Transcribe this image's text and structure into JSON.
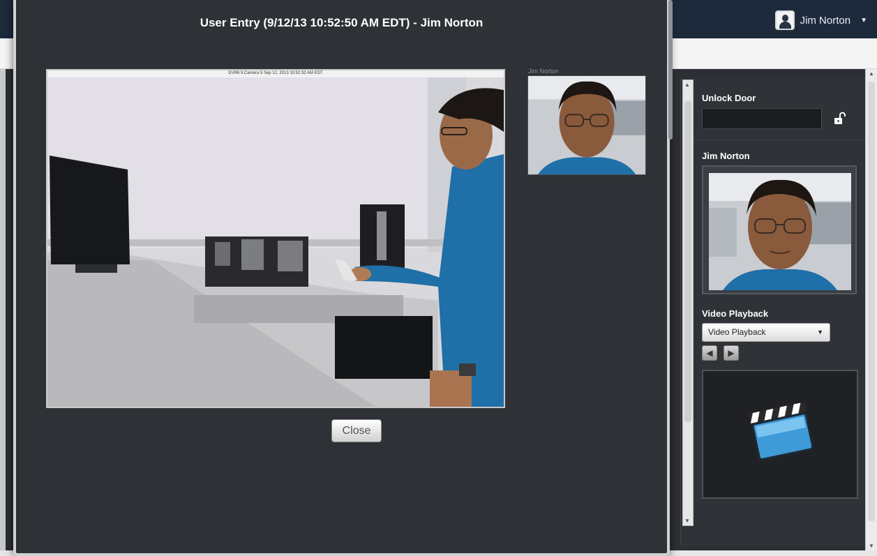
{
  "header": {
    "user_name": "Jim Norton",
    "user_icon": "user-avatar-icon",
    "menu_icon": "chevron-down-icon"
  },
  "modal": {
    "title": "User Entry (9/12/13 10:52:50 AM EDT) - Jim Norton",
    "camera_caption": "DVR6 5:Camera 5 Sep 12, 2013 10:52:32 AM EDT",
    "thumbnail_label": "Jim Norton",
    "close_label": "Close"
  },
  "panel": {
    "unlock_title": "Unlock Door",
    "unlock_icon": "unlock-icon",
    "unlock_value": "",
    "person_title": "Jim Norton",
    "video_title": "Video Playback",
    "video_select_value": "Video Playback",
    "prev_icon": "arrow-left-icon",
    "next_icon": "arrow-right-icon",
    "video_icon": "clapperboard-icon"
  },
  "colors": {
    "topbar": "#1d2a3c",
    "modal_bg": "#2e3135",
    "panel_bg": "#2f3338",
    "shirt_blue": "#1f6fa8"
  }
}
